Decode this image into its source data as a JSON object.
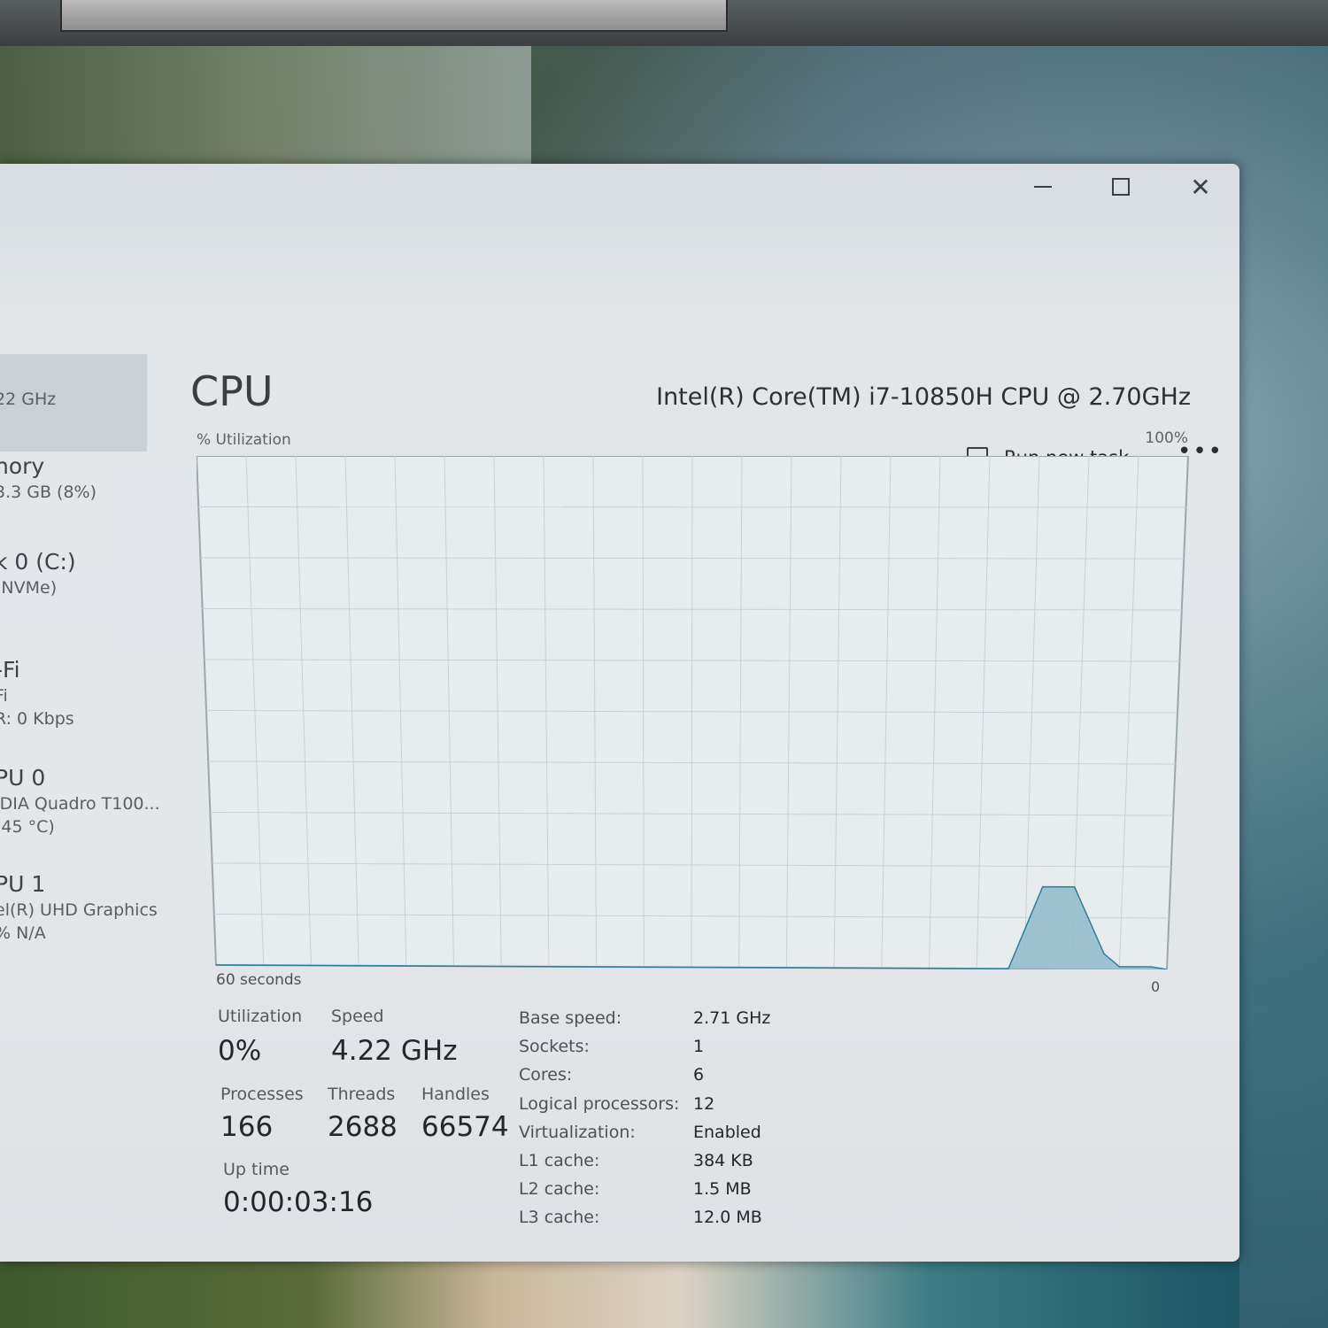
{
  "window": {
    "controls": {
      "minimize_icon": "minimize-icon",
      "maximize_icon": "maximize-icon",
      "close_glyph": "✕"
    },
    "toolbar": {
      "run_new_task": "Run new task",
      "more_glyph": "•••"
    }
  },
  "sidebar": {
    "items": [
      {
        "title": "",
        "sub": "22 GHz"
      },
      {
        "title": "nory",
        "sub": "3.3 GB (8%)"
      },
      {
        "title": "k 0 (C:)",
        "sub": "(NVMe)"
      },
      {
        "title": "-Fi",
        "sub": "Fi",
        "sub2": "R: 0 Kbps"
      },
      {
        "title": "PU 0",
        "sub": "IDIA Quadro T100...",
        "sub2": "(45 °C)"
      },
      {
        "title": "PU 1",
        "sub": "el(R) UHD Graphics",
        "sub2": "% N/A"
      }
    ]
  },
  "main": {
    "title": "CPU",
    "model": "Intel(R) Core(TM) i7-10850H CPU @ 2.70GHz",
    "graph": {
      "y_label": "% Utilization",
      "y_max_label": "100%",
      "x_left_label": "60 seconds",
      "x_right_label": "0",
      "fill_color": "#8fbccb",
      "line_color": "#2d7f9a",
      "grid_color": "#c7d3d8"
    },
    "stats": {
      "utilization_label": "Utilization",
      "utilization_value": "0%",
      "speed_label": "Speed",
      "speed_value": "4.22 GHz",
      "processes_label": "Processes",
      "processes_value": "166",
      "threads_label": "Threads",
      "threads_value": "2688",
      "handles_label": "Handles",
      "handles_value": "66574",
      "uptime_label": "Up time",
      "uptime_value": "0:00:03:16"
    },
    "specs": [
      {
        "label": "Base speed:",
        "value": "2.71 GHz"
      },
      {
        "label": "Sockets:",
        "value": "1"
      },
      {
        "label": "Cores:",
        "value": "6"
      },
      {
        "label": "Logical processors:",
        "value": "12"
      },
      {
        "label": "Virtualization:",
        "value": "Enabled"
      },
      {
        "label": "L1 cache:",
        "value": "384 KB"
      },
      {
        "label": "L2 cache:",
        "value": "1.5 MB"
      },
      {
        "label": "L3 cache:",
        "value": "12.0 MB"
      }
    ]
  },
  "chart_data": {
    "type": "area",
    "x_unit": "seconds ago",
    "xlim": [
      60,
      0
    ],
    "ylim": [
      0,
      100
    ],
    "x": [
      60,
      52,
      10,
      8,
      6,
      4,
      3,
      1,
      0
    ],
    "values": [
      0,
      0,
      0,
      16,
      16,
      3,
      0.5,
      0.5,
      0
    ]
  }
}
